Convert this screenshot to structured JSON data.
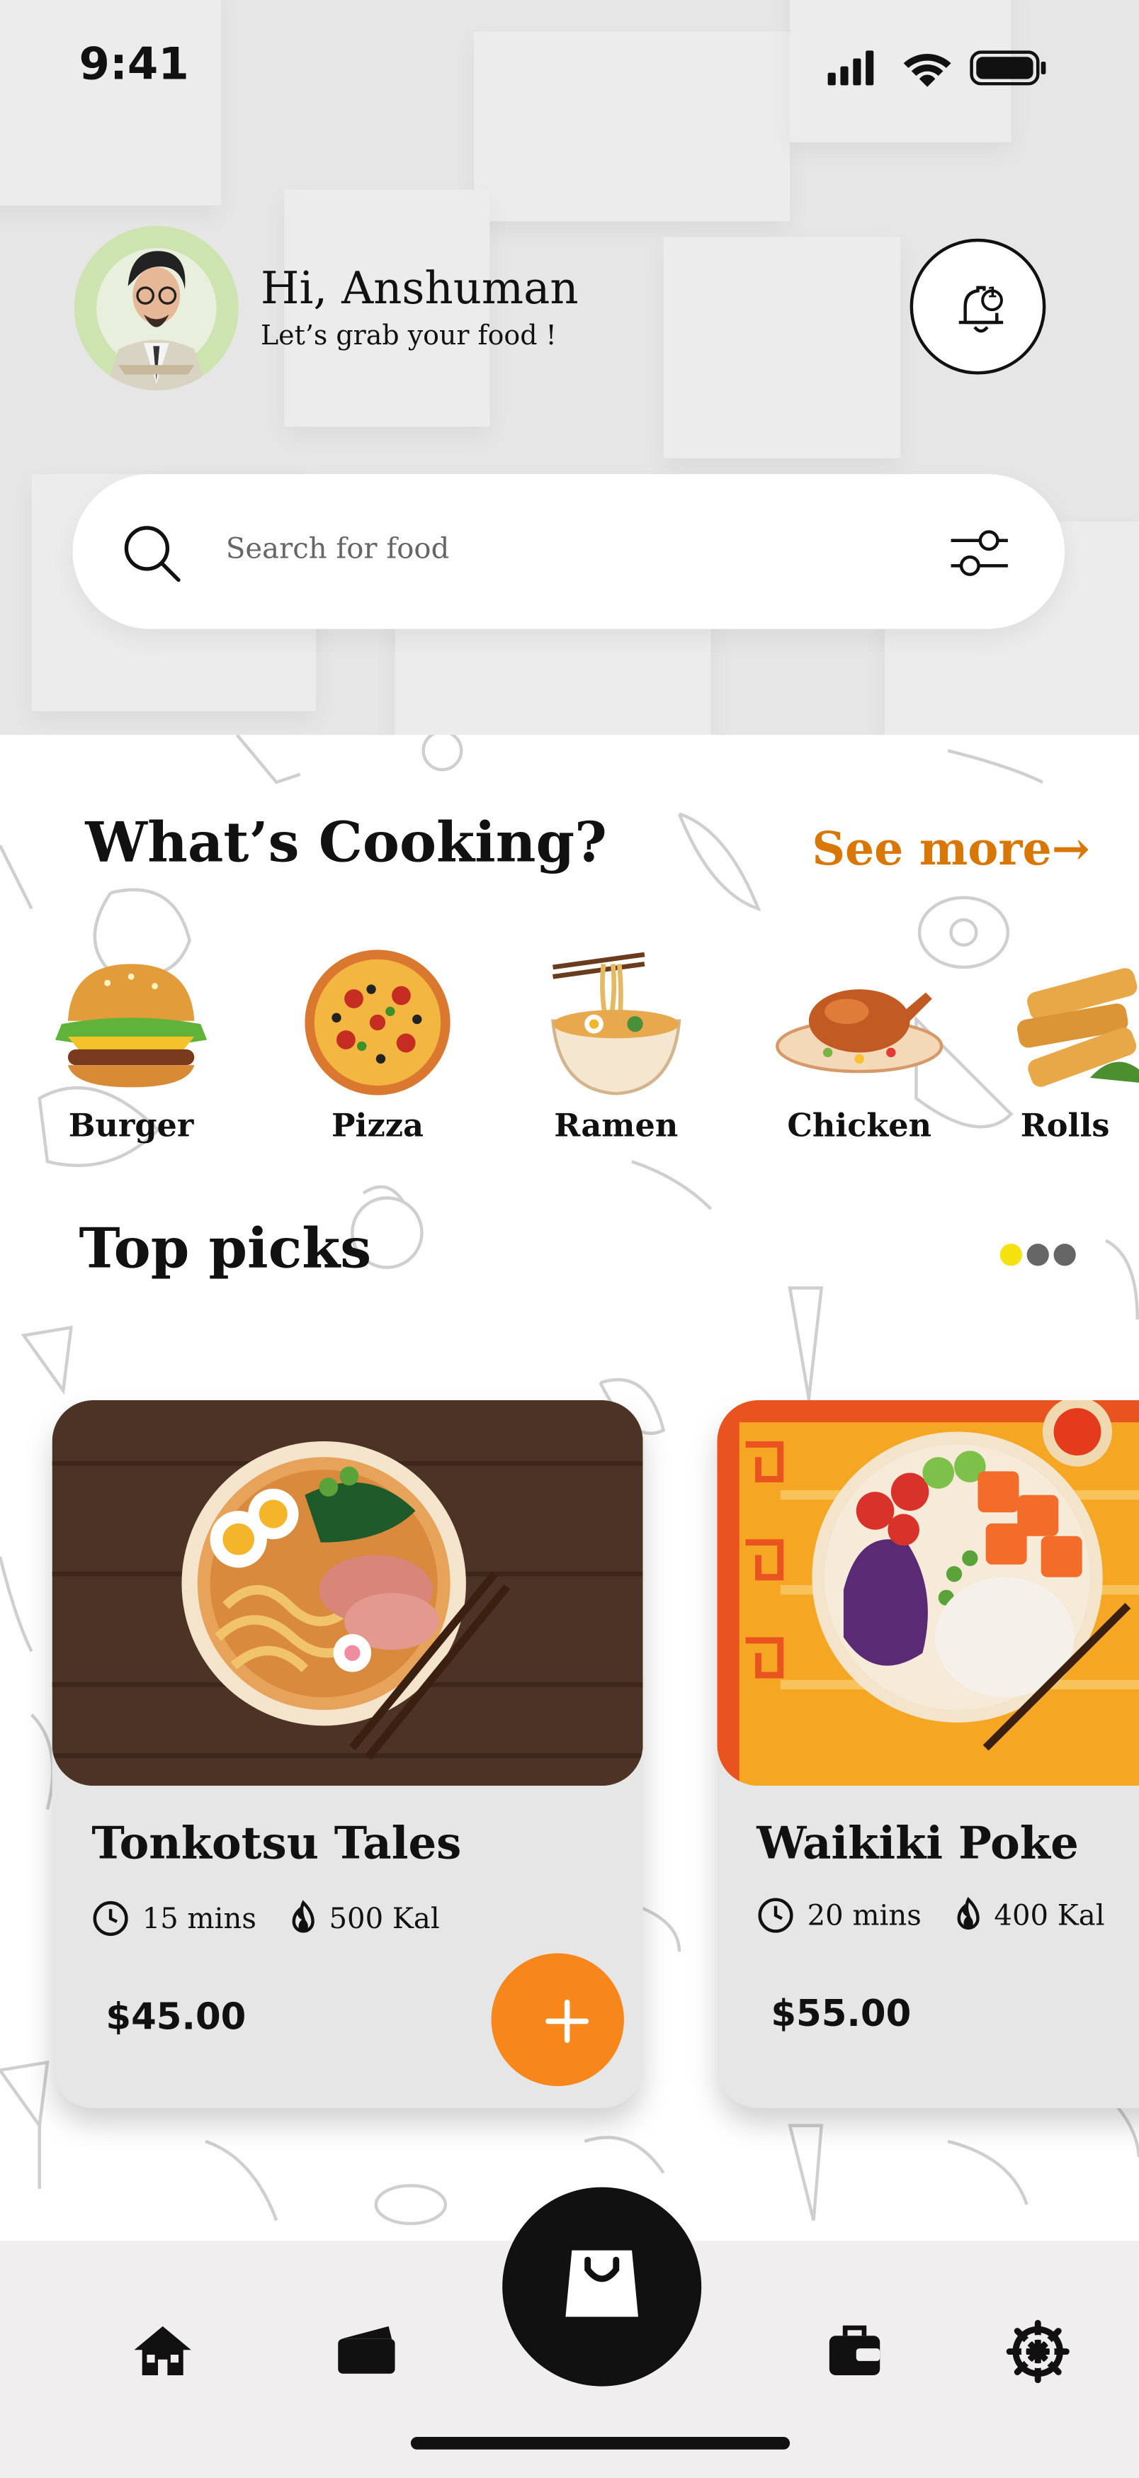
{
  "status_bar": {
    "time": "9:41"
  },
  "header": {
    "greeting": "Hi, Anshuman",
    "subtitle": "Let’s grab your food !",
    "notification_count": "1"
  },
  "search": {
    "placeholder": "Search for food"
  },
  "categories_section": {
    "title": "What’s Cooking?",
    "see_more": "See more→",
    "items": [
      {
        "label": "Burger"
      },
      {
        "label": "Pizza"
      },
      {
        "label": "Ramen"
      },
      {
        "label": "Chicken"
      },
      {
        "label": "Rolls"
      }
    ]
  },
  "top_picks": {
    "title": "Top picks",
    "pagination": {
      "active_color": "#f5e10e",
      "inactive_color": "#666666",
      "count": 3,
      "active_index": 0
    },
    "cards": [
      {
        "name": "Tonkotsu Tales",
        "time": "15 mins",
        "calories": "500 Kal",
        "price": "$45.00",
        "add_label": "+"
      },
      {
        "name": "Waikiki Poke",
        "time": "20 mins",
        "calories": "400 Kal",
        "price": "$55.00"
      }
    ]
  },
  "bottom_nav": {
    "items": [
      "home-icon",
      "wallet-card-icon",
      "shopping-bag-icon",
      "briefcase-icon",
      "settings-gear-icon"
    ]
  },
  "colors": {
    "accent": "#f7861b",
    "link": "#d97706",
    "dark": "#111111"
  }
}
